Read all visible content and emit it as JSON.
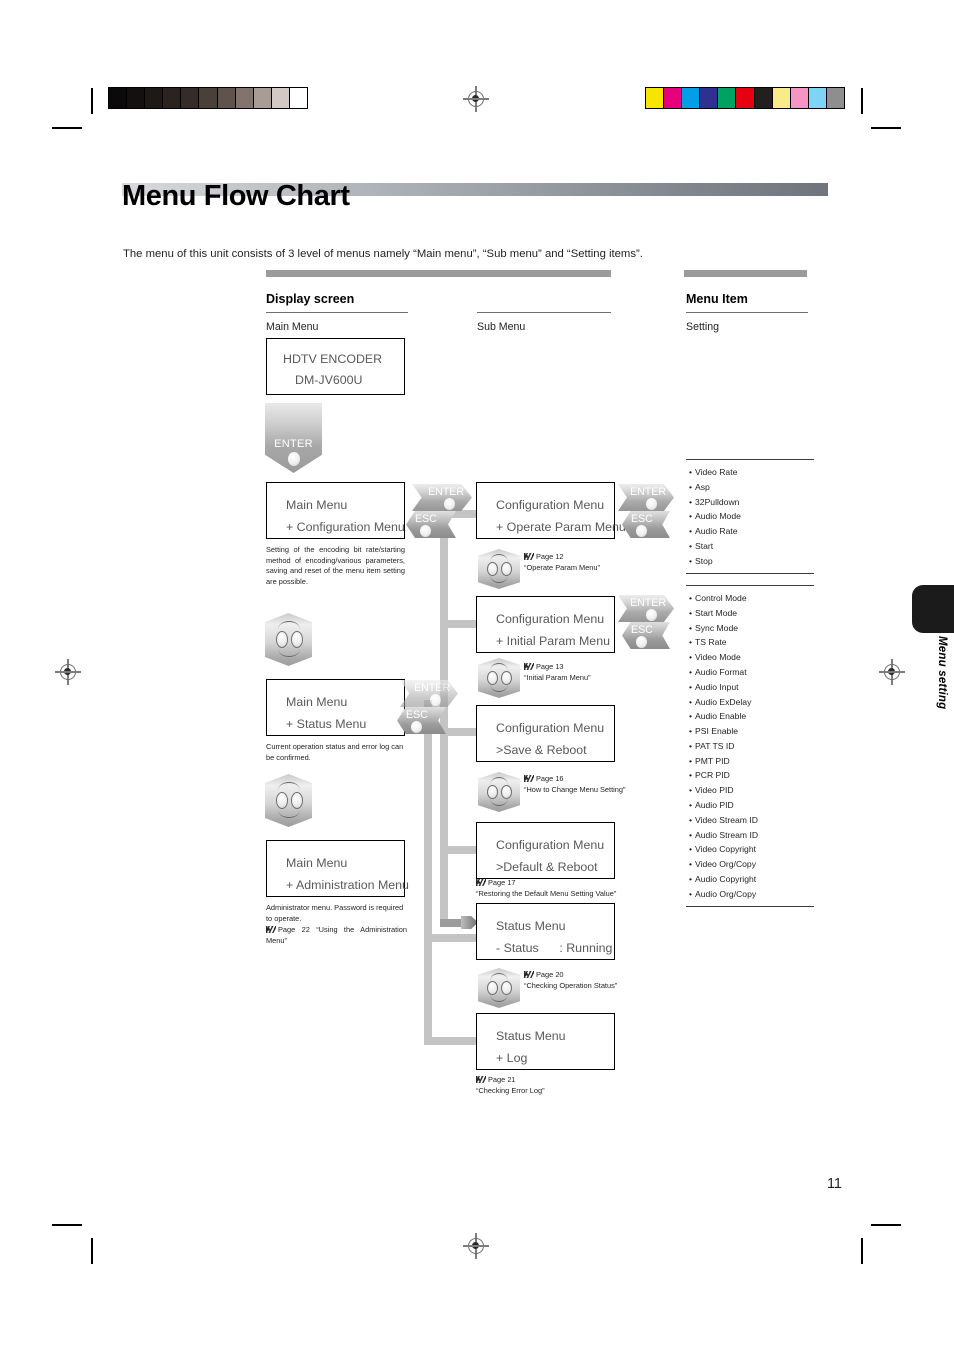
{
  "document": {
    "title": "Menu Flow Chart",
    "intro": "The menu of this unit consists of 3 level of menus namely “Main menu”, “Sub menu” and “Setting items”.",
    "page_number": "11",
    "side_tab_label": "Menu setting"
  },
  "columns": {
    "display_screen": {
      "heading": "Display screen",
      "subheading": "Main Menu"
    },
    "sub_menu": {
      "subheading": "Sub Menu"
    },
    "menu_item": {
      "heading": "Menu Item",
      "subheading": "Setting"
    }
  },
  "device_box": {
    "line1": "HDTV ENCODER",
    "line2": "DM-JV600U"
  },
  "buttons": {
    "enter": "ENTER",
    "esc": "ESC"
  },
  "main_menus": [
    {
      "line1": "Main Menu",
      "line2": "+ Configuration Menu",
      "caption": "Setting of the encoding bit rate/starting method of encoding/various parameters, saving and reset of the menu item setting are possible."
    },
    {
      "line1": "Main Menu",
      "line2": "+ Status Menu",
      "caption": "Current operation status and error log can be confirmed."
    },
    {
      "line1": "Main Menu",
      "line2": "+ Administration Menu",
      "caption": "Administrator menu. Password is required to operate.",
      "ref_page": "Page 22",
      "ref_title": "“Using the Administration Menu”"
    }
  ],
  "sub_menus": [
    {
      "line1": "Configuration Menu",
      "line2": "+ Operate Param Menu",
      "ref_page": "Page 12",
      "ref_title": "“Operate Param Menu”"
    },
    {
      "line1": "Configuration Menu",
      "line2": "+ Initial Param Menu",
      "ref_page": "Page 13",
      "ref_title": "“Initial Param Menu”"
    },
    {
      "line1": "Configuration Menu",
      "line2": ">Save & Reboot",
      "ref_page": "Page 16",
      "ref_title": "“How to Change Menu Setting”"
    },
    {
      "line1": "Configuration Menu",
      "line2": ">Default & Reboot",
      "ref_page": "Page 17",
      "ref_title": "“Restoring the Default Menu Setting Value”"
    },
    {
      "line1": "Status Menu",
      "line2": "- Status      : Running",
      "ref_page": "Page 20",
      "ref_title": "“Checking Operation Status”"
    },
    {
      "line1": "Status Menu",
      "line2": "+ Log",
      "ref_page": "Page 21",
      "ref_title": "“Checking Error Log”"
    }
  ],
  "setting_groups": [
    {
      "items": [
        "Video Rate",
        "Asp",
        "32Pulldown",
        "Audio Mode",
        "Audio Rate",
        "Start",
        "Stop"
      ]
    },
    {
      "items": [
        "Control Mode",
        "Start Mode",
        "Sync Mode",
        "TS Rate",
        "Video Mode",
        "Audio Format",
        "Audio Input",
        "Audio ExDelay",
        "Audio Enable",
        "PSI Enable",
        "PAT TS ID",
        "PMT PID",
        "PCR PID",
        "Video PID",
        "Audio PID",
        "Video Stream ID",
        "Audio Stream ID",
        "Video Copyright",
        "Video Org/Copy",
        "Audio Copyright",
        "Audio Org/Copy"
      ]
    }
  ],
  "print_marks": {
    "grayscale_bar": [
      "#0b0909",
      "#151010",
      "#1e1816",
      "#2b231f",
      "#352c27",
      "#4b3f39",
      "#60534c",
      "#82746d",
      "#a89c96",
      "#d2c8c4",
      "#ffffff"
    ],
    "color_bar": [
      "#f6e500",
      "#e6007e",
      "#00a0e9",
      "#2f3192",
      "#00a261",
      "#e60012",
      "#231f20",
      "#fbeb86",
      "#f694c4",
      "#7fd3f4",
      "#8e8e8e"
    ]
  }
}
